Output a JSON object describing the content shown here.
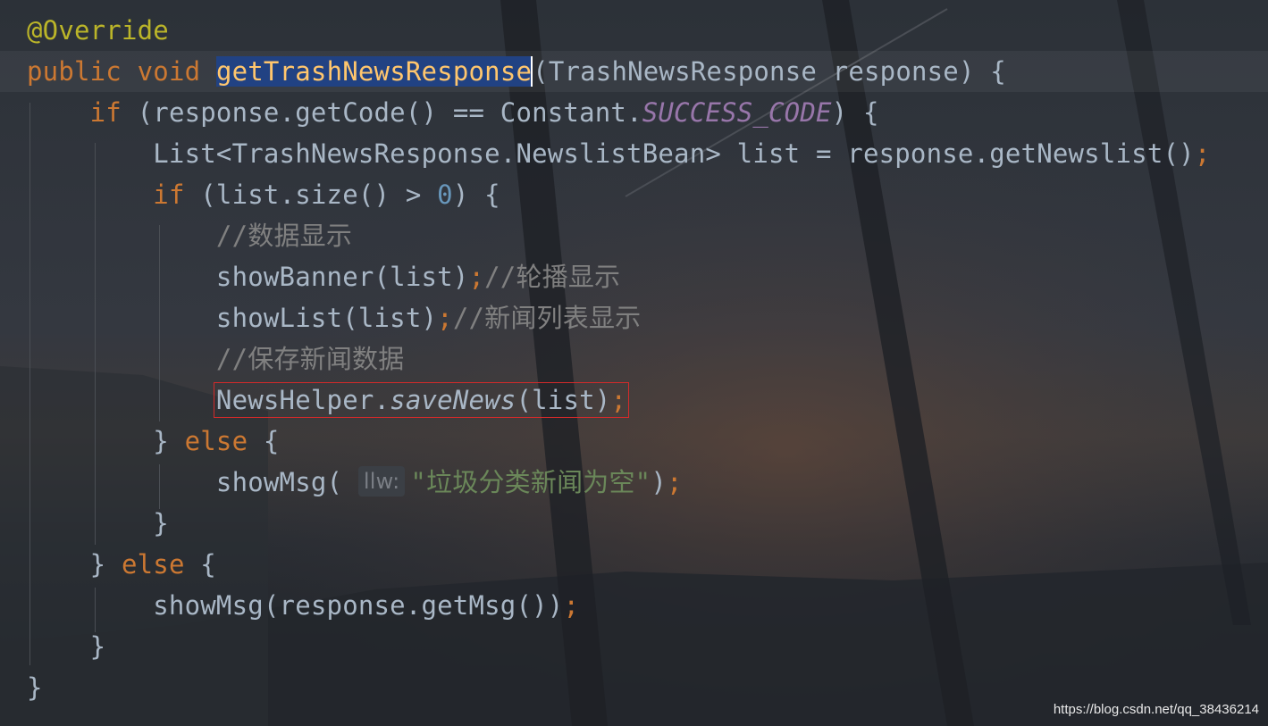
{
  "editor": {
    "lines": [
      {
        "id": "annotation",
        "tokens": [
          {
            "t": "@Override",
            "c": "ann"
          }
        ]
      },
      {
        "id": "method-signature",
        "current": true,
        "tokens": [
          {
            "t": "public",
            "c": "kw"
          },
          {
            "t": " "
          },
          {
            "t": "void",
            "c": "kw"
          },
          {
            "t": " "
          },
          {
            "t": "getTrashNewsResponse",
            "c": "fn sel",
            "name": "selected-method-name"
          },
          {
            "t": "",
            "c": "caret",
            "name": "text-caret"
          },
          {
            "t": "(TrashNewsResponse response) {"
          }
        ]
      },
      {
        "id": "if-success",
        "tokens": [
          {
            "t": "    "
          },
          {
            "t": "if",
            "c": "kw"
          },
          {
            "t": " (response.getCode() == Constant."
          },
          {
            "t": "SUCCESS_CODE",
            "c": "const"
          },
          {
            "t": ") {"
          }
        ]
      },
      {
        "id": "list-declaration",
        "tokens": [
          {
            "t": "        List<TrashNewsResponse.NewslistBean> list = response.getNewslist()"
          },
          {
            "t": ";",
            "c": "semi"
          }
        ]
      },
      {
        "id": "if-size",
        "tokens": [
          {
            "t": "        "
          },
          {
            "t": "if",
            "c": "kw"
          },
          {
            "t": " (list.size() > "
          },
          {
            "t": "0",
            "c": "num"
          },
          {
            "t": ") {"
          }
        ]
      },
      {
        "id": "comment-show-data",
        "tokens": [
          {
            "t": "            "
          },
          {
            "t": "//数据显示",
            "c": "cmt"
          }
        ]
      },
      {
        "id": "show-banner",
        "tokens": [
          {
            "t": "            showBanner(list)"
          },
          {
            "t": ";",
            "c": "semi"
          },
          {
            "t": "//轮播显示",
            "c": "cmt"
          }
        ]
      },
      {
        "id": "show-list",
        "tokens": [
          {
            "t": "            showList(list)"
          },
          {
            "t": ";",
            "c": "semi"
          },
          {
            "t": "//新闻列表显示",
            "c": "cmt"
          }
        ]
      },
      {
        "id": "comment-save-news",
        "tokens": [
          {
            "t": "            "
          },
          {
            "t": "//保存新闻数据",
            "c": "cmt"
          }
        ]
      },
      {
        "id": "save-news",
        "tokens": [
          {
            "t": "            "
          },
          {
            "t": "NewsHelper.",
            "c": "boxed-start"
          },
          {
            "t": "saveNews",
            "c": "ital"
          },
          {
            "t": "(list)"
          },
          {
            "t": ";",
            "c": "semi"
          }
        ],
        "boxed": true
      },
      {
        "id": "else-inner",
        "tokens": [
          {
            "t": "        } "
          },
          {
            "t": "else",
            "c": "kw"
          },
          {
            "t": " {"
          }
        ]
      },
      {
        "id": "show-msg-empty",
        "tokens": [
          {
            "t": "            showMsg( "
          },
          {
            "t": "llw:",
            "c": "hint",
            "name": "parameter-hint"
          },
          {
            "t": "\"垃圾分类新闻为空\"",
            "c": "str"
          },
          {
            "t": ")"
          },
          {
            "t": ";",
            "c": "semi"
          }
        ]
      },
      {
        "id": "close-inner-else",
        "tokens": [
          {
            "t": "        }"
          }
        ]
      },
      {
        "id": "else-outer",
        "tokens": [
          {
            "t": "    } "
          },
          {
            "t": "else",
            "c": "kw"
          },
          {
            "t": " {"
          }
        ]
      },
      {
        "id": "show-msg-response",
        "tokens": [
          {
            "t": "        showMsg(response.getMsg())"
          },
          {
            "t": ";",
            "c": "semi"
          }
        ]
      },
      {
        "id": "close-outer-else",
        "tokens": [
          {
            "t": "    }"
          }
        ]
      },
      {
        "id": "close-method",
        "tokens": [
          {
            "t": "}"
          }
        ]
      }
    ]
  },
  "watermark": "https://blog.csdn.net/qq_38436214",
  "colors": {
    "keyword": "#cc7832",
    "annotation": "#bbb529",
    "method": "#ffc66d",
    "comment": "#808080",
    "string": "#6a8759",
    "number": "#6897bb",
    "constant": "#9876aa",
    "text": "#a9b7c6",
    "selection": "#214283",
    "highlight_box": "#d32a2a"
  }
}
